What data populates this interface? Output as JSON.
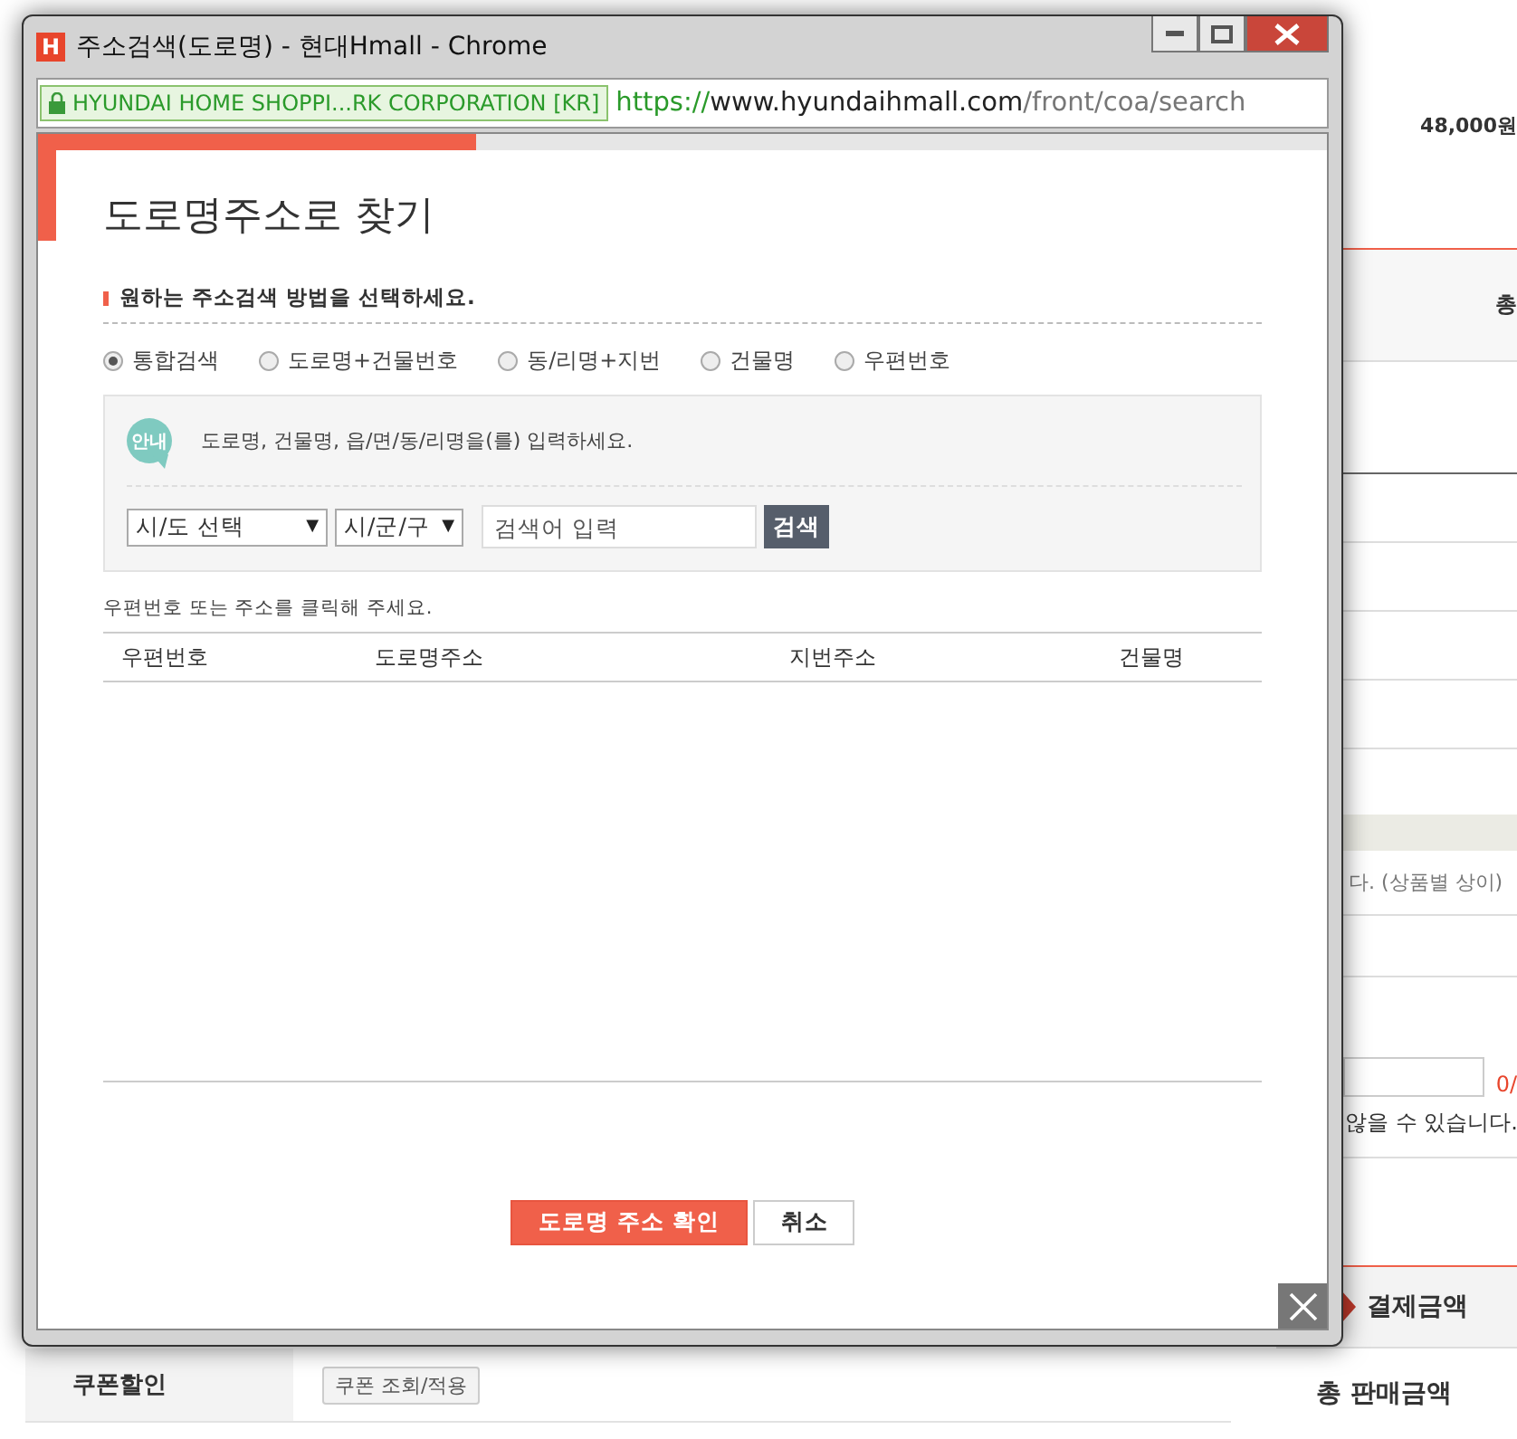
{
  "background_page": {
    "price": "48,000원",
    "total_label": "총",
    "note": "다. (상품별 상이)",
    "counter": "0/",
    "notice": "않을 수 있습니다.",
    "payment_heading": "결제금액",
    "total_sales_label": "총 판매금액",
    "coupon_row": {
      "label": "쿠폰할인",
      "button": "쿠폰 조회/적용"
    }
  },
  "popup_window": {
    "title": "주소검색(도로명) - 현대Hmall - Chrome",
    "app_badge": "H",
    "certificate": "HYUNDAI HOME SHOPPI...RK CORPORATION [KR]",
    "url": {
      "scheme": "https://",
      "host": "www.hyundaihmall.com",
      "path": "/front/coa/search"
    },
    "heading": "도로명주소로 찾기",
    "section_label": "원하는 주소검색 방법을 선택하세요.",
    "search_methods": [
      {
        "label": "통합검색",
        "selected": true
      },
      {
        "label": "도로명+건물번호",
        "selected": false
      },
      {
        "label": "동/리명+지번",
        "selected": false
      },
      {
        "label": "건물명",
        "selected": false
      },
      {
        "label": "우편번호",
        "selected": false
      }
    ],
    "guide": {
      "badge": "안내",
      "text": "도로명, 건물명, 읍/면/동/리명을(를) 입력하세요."
    },
    "selects": [
      {
        "value": "시/도 선택",
        "caret": "▼"
      },
      {
        "value": "시/군/구",
        "caret": "▼"
      }
    ],
    "search_field": {
      "placeholder": "검색어 입력"
    },
    "search_button": "검색",
    "hint": "우편번호 또는 주소를 클릭해 주세요.",
    "table": {
      "columns": [
        "우편번호",
        "도로명주소",
        "지번주소",
        "건물명"
      ]
    },
    "buttons": [
      {
        "label": "도로명 주소 확인",
        "kind": "primary"
      },
      {
        "label": "취소",
        "kind": "secondary"
      }
    ]
  }
}
